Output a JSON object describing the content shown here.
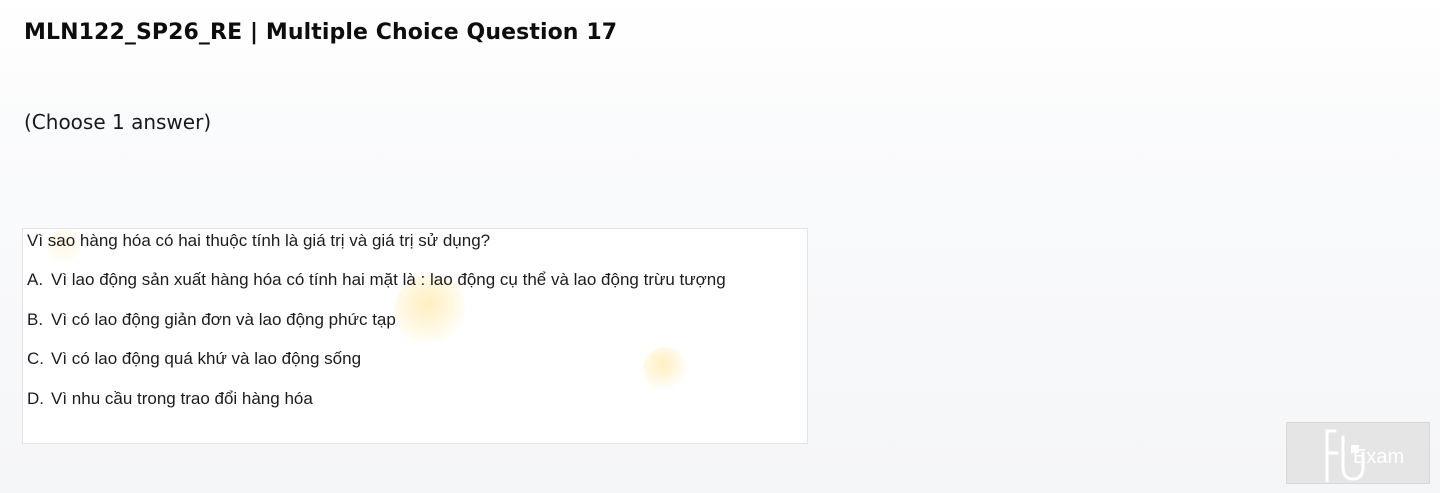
{
  "header": {
    "title": "MLN122_SP26_RE | Multiple Choice Question 17",
    "instruction": "(Choose 1 answer)"
  },
  "question": {
    "text": "Vì sao hàng hóa có hai thuộc tính là giá trị và giá trị sử dụng?",
    "options": [
      {
        "letter": "A.",
        "text": "Vì lao động sản xuất hàng hóa có tính hai mặt là : lao động cụ thể và lao động trừu tượng"
      },
      {
        "letter": "B.",
        "text": "Vì có lao động giản đơn và lao động phức tạp"
      },
      {
        "letter": "C.",
        "text": "Vì có lao động quá khứ và lao động sống"
      },
      {
        "letter": "D.",
        "text": "Vì nhu cầu trong trao đổi hàng hóa"
      }
    ]
  },
  "logo": {
    "text": "Exam",
    "icon": "fu-exam-logo-icon",
    "color": "#ffffff",
    "background": "#e5e5e5"
  }
}
